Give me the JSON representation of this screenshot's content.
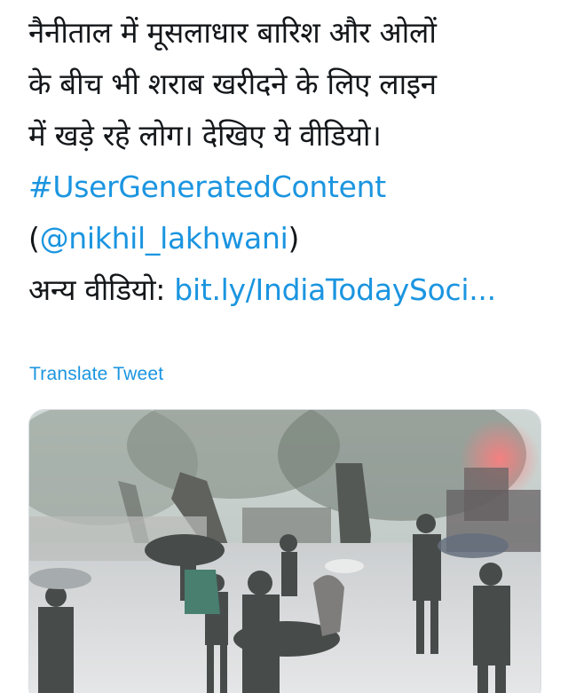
{
  "tweet": {
    "lines": [
      "नैनीताल में मूसलाधार बारिश और ओलों",
      "के बीच भी शराब खरीदने के लिए लाइन",
      "में खड़े रहे लोग। देखिए ये वीडियो।"
    ],
    "hashtag": "#UserGeneratedContent",
    "mention_open": "(",
    "mention": "@nikhil_lakhwani",
    "mention_close": ")",
    "more_label": "अन्य वीडियो:",
    "link": "bit.ly/IndiaTodaySoci..."
  },
  "translate_label": "Translate Tweet",
  "colors": {
    "text": "#14171a",
    "link": "#1b95e0"
  },
  "media": {
    "icon": "video-thumbnail"
  }
}
